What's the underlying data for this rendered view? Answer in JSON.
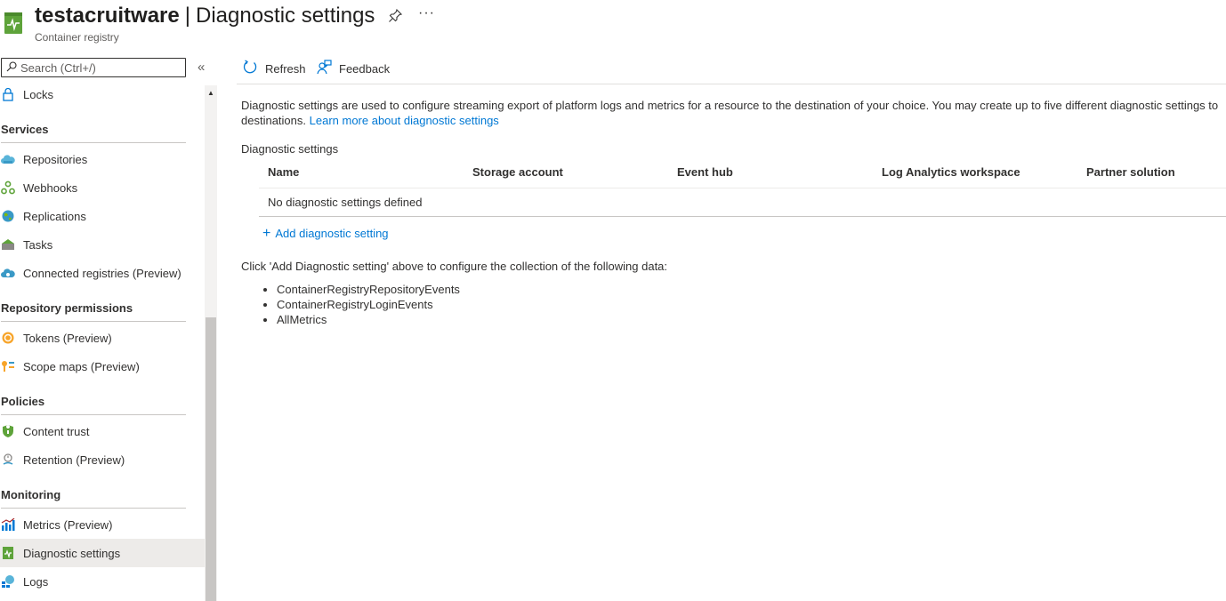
{
  "header": {
    "resource_name": "testacruitware",
    "separator": "|",
    "page_title": "Diagnostic settings",
    "subtitle": "Container registry",
    "more_label": "···"
  },
  "sidebar": {
    "search_placeholder": "Search (Ctrl+/)",
    "collapse_label": "«",
    "items": [
      {
        "label": "Locks",
        "icon": "lock-icon"
      },
      {
        "section": "Services"
      },
      {
        "label": "Repositories",
        "icon": "cloud-icon"
      },
      {
        "label": "Webhooks",
        "icon": "webhook-icon"
      },
      {
        "label": "Replications",
        "icon": "globe-icon"
      },
      {
        "label": "Tasks",
        "icon": "tasks-icon"
      },
      {
        "label": "Connected registries (Preview)",
        "icon": "connected-registry-icon"
      },
      {
        "section": "Repository permissions"
      },
      {
        "label": "Tokens (Preview)",
        "icon": "token-icon"
      },
      {
        "label": "Scope maps (Preview)",
        "icon": "scope-map-icon"
      },
      {
        "section": "Policies"
      },
      {
        "label": "Content trust",
        "icon": "shield-icon"
      },
      {
        "label": "Retention (Preview)",
        "icon": "retention-icon"
      },
      {
        "section": "Monitoring"
      },
      {
        "label": "Metrics (Preview)",
        "icon": "metrics-icon"
      },
      {
        "label": "Diagnostic settings",
        "icon": "diagnostic-icon",
        "active": true
      },
      {
        "label": "Logs",
        "icon": "logs-icon"
      }
    ]
  },
  "toolbar": {
    "refresh_label": "Refresh",
    "feedback_label": "Feedback"
  },
  "main": {
    "description": "Diagnostic settings are used to configure streaming export of platform logs and metrics for a resource to the destination of your choice. You may create up to five different diagnostic settings to",
    "description_line2": "destinations.",
    "learn_more": "Learn more about diagnostic settings",
    "section_label": "Diagnostic settings",
    "table": {
      "columns": [
        "Name",
        "Storage account",
        "Event hub",
        "Log Analytics workspace",
        "Partner solution"
      ],
      "empty_text": "No diagnostic settings defined"
    },
    "add_label": "Add diagnostic setting",
    "hint": "Click 'Add Diagnostic setting' above to configure the collection of the following data:",
    "data_items": [
      "ContainerRegistryRepositoryEvents",
      "ContainerRegistryLoginEvents",
      "AllMetrics"
    ]
  },
  "colors": {
    "accent": "#0078d4",
    "active_bg": "#edebe9",
    "resource_icon": "#5ea33a"
  }
}
